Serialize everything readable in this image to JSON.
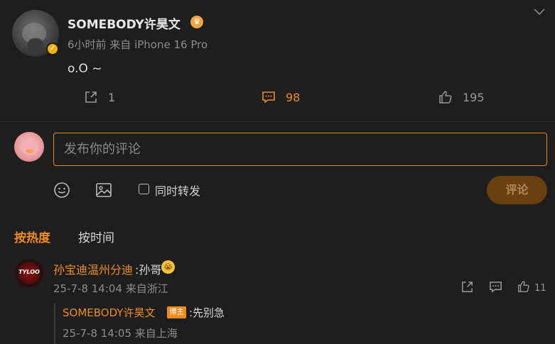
{
  "post": {
    "username": "SOMEBODY许昊文",
    "meta": "6小时前 来自 iPhone 16 Pro",
    "text": "o.O ~",
    "verified_icon": "verified-badge-icon",
    "crown_icon": "crown-icon",
    "actions": {
      "share_count": "1",
      "comment_count": "98",
      "like_count": "195"
    }
  },
  "compose": {
    "placeholder": "发布你的评论",
    "repost_label": "同时转发",
    "submit_label": "评论"
  },
  "sort_tabs": {
    "hot": "按热度",
    "time": "按时间"
  },
  "comments": [
    {
      "author": "孙宝迪温州分迪",
      "text": ":孙哥",
      "avatar_text": "TYLOO",
      "meta": "25-7-8 14:04 来自浙江",
      "like_count": "11",
      "replies": [
        {
          "author": "SOMEBODY许昊文",
          "badge": "博主",
          "text": ":先别急",
          "meta": "25-7-8 14:05 来自上海"
        }
      ]
    }
  ],
  "colors": {
    "accent": "#f08c1f",
    "background": "#1e1e1e",
    "muted": "#8c8c8c"
  }
}
